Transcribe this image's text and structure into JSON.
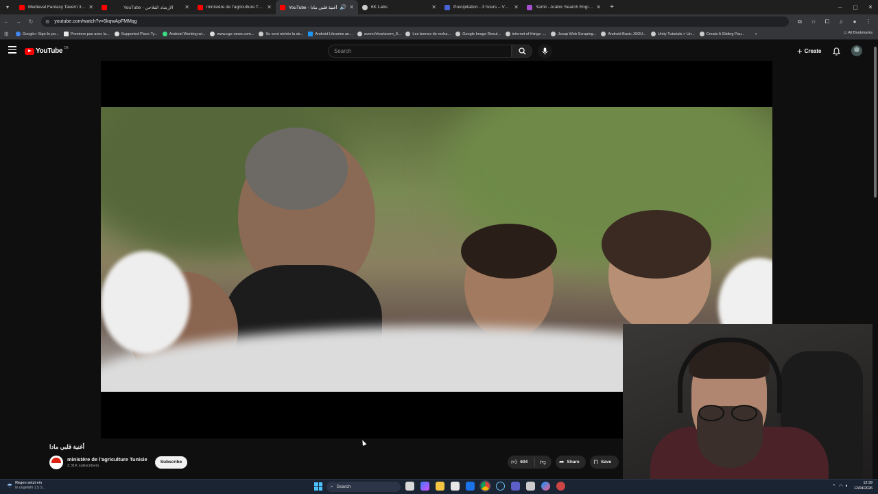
{
  "browser": {
    "tabs": [
      {
        "title": "Medieval Fantasy Tavern 3 | D&...",
        "favicon_color": "#ff0000",
        "active": false
      },
      {
        "title": "",
        "favicon_color": "#ff0000",
        "active": false
      },
      {
        "title": "YouTube - الإرشاد الفلاحي",
        "favicon_color": "#ff0000",
        "active": false
      },
      {
        "title": "ministère de l'agriculture Tunisi...",
        "favicon_color": "#ff0000",
        "active": false
      },
      {
        "title": "YouTube - أغنية قلبي مادا",
        "favicon_color": "#ff0000",
        "active": true
      },
      {
        "title": "6K Labs",
        "favicon_color": "#cccccc",
        "active": false
      },
      {
        "title": "Precipitation - 3 hours – Ventus...",
        "favicon_color": "#4a62d8",
        "active": false
      },
      {
        "title": "Yamli - Arabic Search Engine an...",
        "favicon_color": "#a64fd1",
        "active": false
      }
    ],
    "url": "youtube.com/watch?v=5kqwApFMMqg",
    "bookmarks": [
      "Google+ Sign-In po...",
      "Premiers pas avec la...",
      "Supported Place Ty...",
      "Android Working wi...",
      "www.cge-news.com...",
      "Se sont nichés la str...",
      "Android Libraries an...",
      "avem.fr/rss/avem_fl...",
      "Les bornes de recha...",
      "Google Image Resul...",
      "internet of things -...",
      "Jsoup Web Scraping...",
      "Android Basic JSOU...",
      "Unity Tutorials > Un...",
      "Create A Sliding Pau..."
    ],
    "all_bookmarks_label": "All Bookmarks"
  },
  "youtube": {
    "logo_text": "YouTube",
    "country_code": "DE",
    "search_placeholder": "Search",
    "create_label": "Create",
    "video_title": "أغنية قلبي مادا",
    "channel_name": "ministère de l'agriculture Tunisie",
    "subscribers": "2.31K subscribers",
    "subscribe_label": "Subscribe",
    "like_count": "604",
    "share_label": "Share",
    "save_label": "Save"
  },
  "taskbar": {
    "weather_title": "Regen setzt ein",
    "weather_sub": "In ungefähr 1.5 S...",
    "search_label": "Search",
    "time": "12:39",
    "date": "12/04/2026"
  },
  "colors": {
    "youtube_red": "#ff0000",
    "background": "#0f0f0f",
    "taskbar": "#1b2433"
  }
}
